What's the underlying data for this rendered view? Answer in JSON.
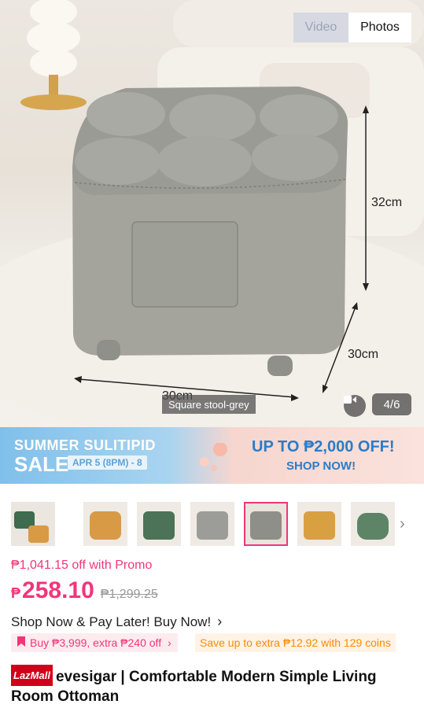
{
  "media": {
    "tabs": [
      {
        "label": "Video",
        "active": false
      },
      {
        "label": "Photos",
        "active": true
      }
    ],
    "dimensions": {
      "height": "32cm",
      "depth": "30cm",
      "width": "30cm"
    },
    "variant_caption": "Square stool-grey",
    "counter": "4/6"
  },
  "banner": {
    "title_line1": "SUMMER SULITIPID",
    "title_line2": "SALE",
    "date": "APR 5 (8PM) - 8",
    "offer": "UP TO ₱2,000 OFF!",
    "cta": "SHOP NOW!"
  },
  "thumbnails": [
    {
      "color": "#3f6b4f",
      "selected": false
    },
    {
      "color": "#d99a45",
      "selected": false
    },
    {
      "color": "#4c7357",
      "selected": false
    },
    {
      "color": "#9c9d98",
      "selected": false
    },
    {
      "color": "#8e8f88",
      "selected": true
    },
    {
      "color": "#d9a042",
      "selected": false
    },
    {
      "color": "#5d8466",
      "selected": false
    }
  ],
  "price": {
    "promo_text": "₱1,041.15 off with Promo",
    "currency": "₱",
    "current": "258.10",
    "original": "₱1,299.25"
  },
  "paylater": {
    "label": "Shop Now & Pay Later! Buy Now!"
  },
  "vouchers": [
    {
      "label": "Buy ₱3,999, extra ₱240 off"
    },
    {
      "label": "Save up to extra ₱12.92 with 129 coins"
    }
  ],
  "product": {
    "badge": "LazMall",
    "title": "evesigar | Comfortable Modern Simple Living Room Ottoman"
  },
  "colors": {
    "accent": "#f2357a",
    "banner_blue": "#2b7cc8",
    "coins": "#ff8a00"
  }
}
